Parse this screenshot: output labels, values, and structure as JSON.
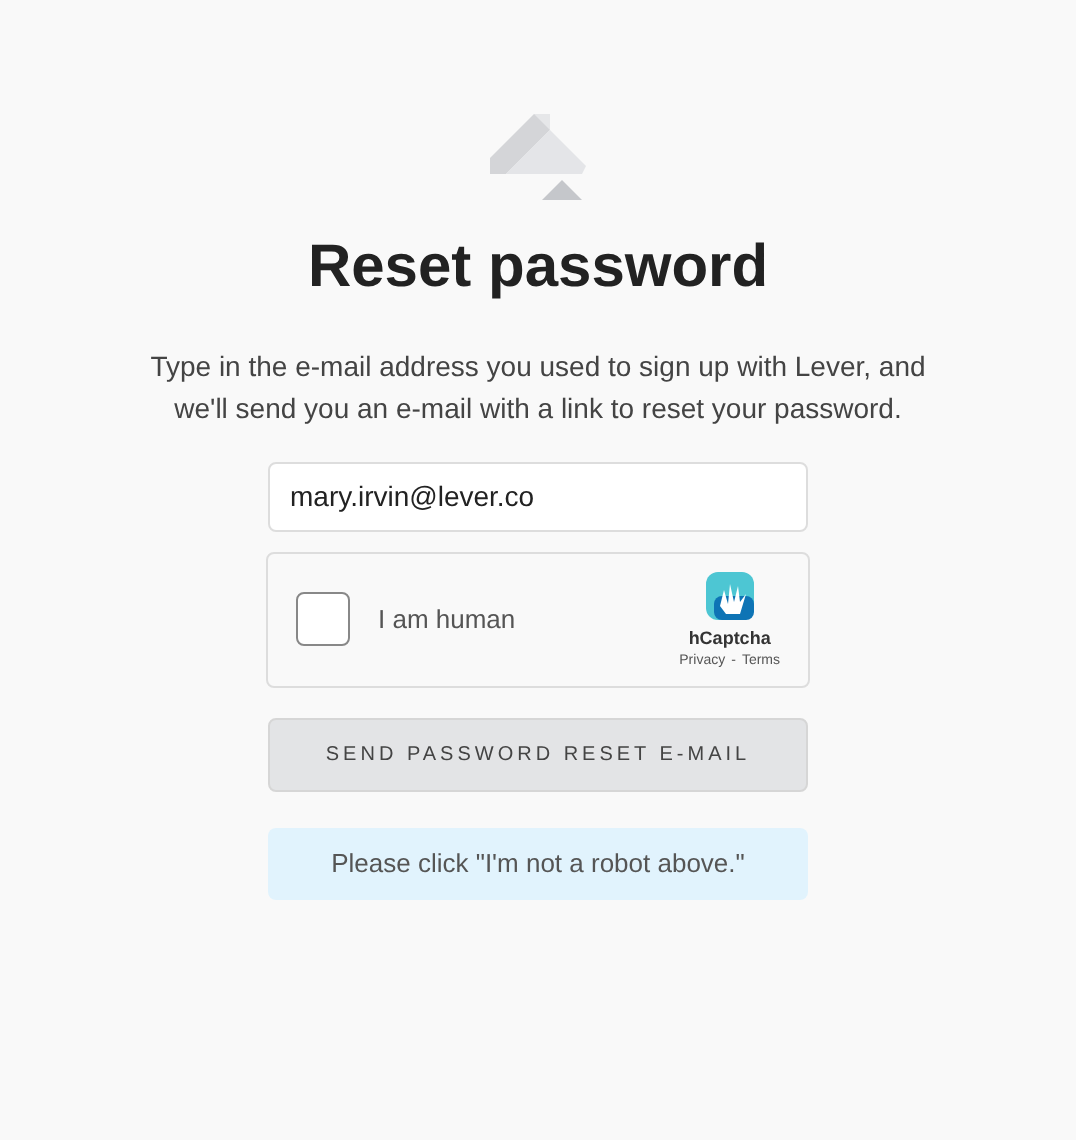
{
  "title": "Reset password",
  "description": "Type in the e-mail address you used to sign up with Lever, and we'll send you an e-mail with a link to reset your password.",
  "email": {
    "value": "mary.irvin@lever.co"
  },
  "captcha": {
    "label": "I am human",
    "checked": false,
    "brand": "hCaptcha",
    "privacy": "Privacy",
    "separator": "-",
    "terms": "Terms"
  },
  "button": "SEND PASSWORD RESET E-MAIL",
  "alert": "Please click \"I'm not a robot above.\""
}
